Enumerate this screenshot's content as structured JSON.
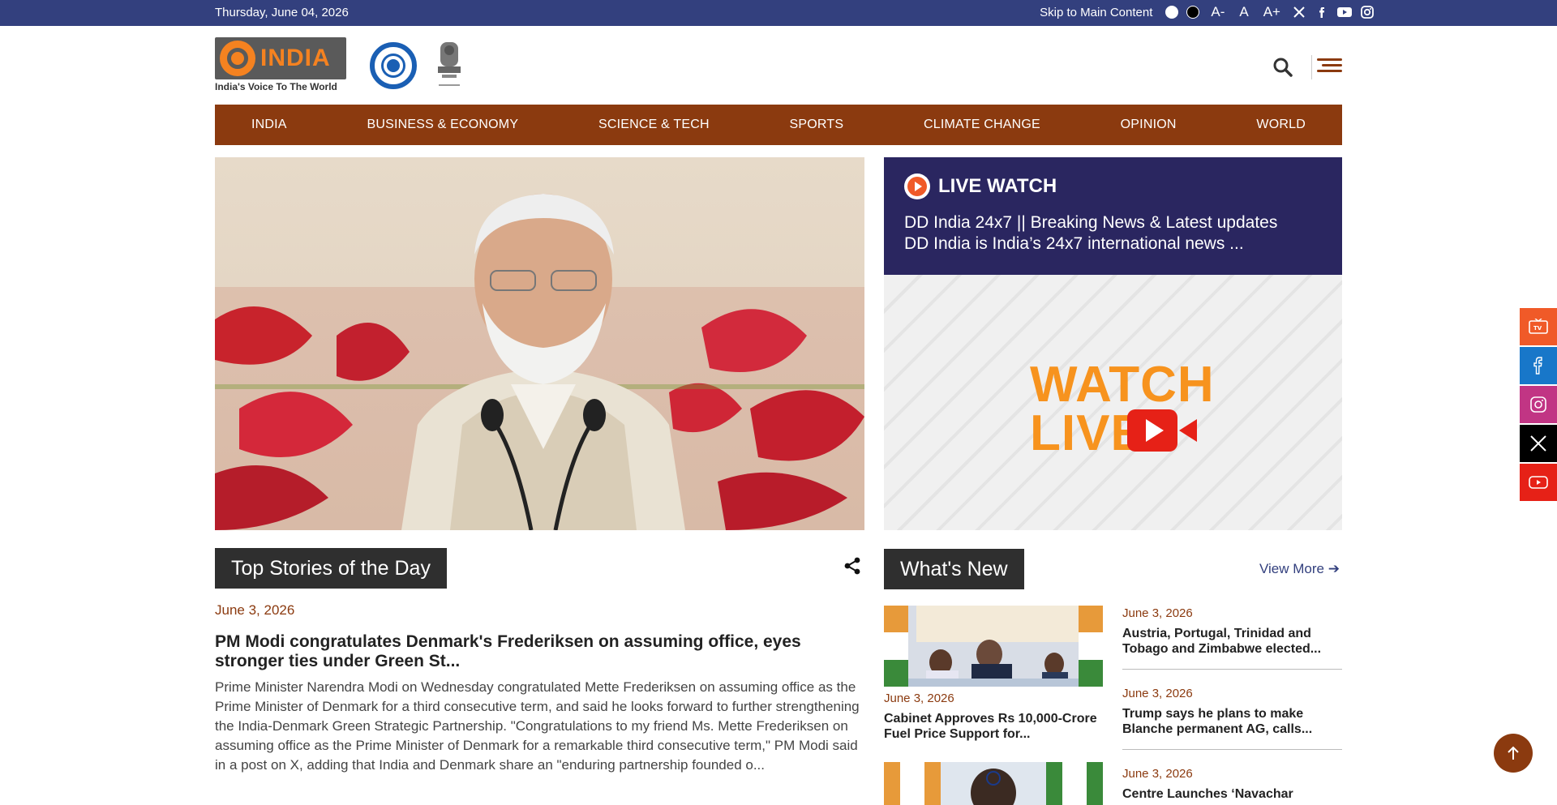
{
  "topbar": {
    "date": "Thursday, June 04, 2026",
    "skip_link": "Skip to Main Content",
    "font_small": "A-",
    "font_normal": "A",
    "font_large": "A+"
  },
  "header": {
    "logo_text": "INDIA",
    "logo_tagline": "India's Voice To The World"
  },
  "nav": {
    "items": [
      "INDIA",
      "BUSINESS & ECONOMY",
      "SCIENCE & TECH",
      "SPORTS",
      "CLIMATE CHANGE",
      "OPINION",
      "WORLD"
    ]
  },
  "live": {
    "heading": "LIVE WATCH",
    "line1": "DD India 24x7 || Breaking News & Latest updates",
    "line2": "DD India is India’s 24x7 international news ...",
    "banner_word1": "WATCH",
    "banner_word2": "LIVE"
  },
  "top_stories": {
    "section_title": "Top Stories of the Day",
    "date": "June 3, 2026",
    "title": "PM Modi congratulates Denmark's Frederiksen on assuming office, eyes stronger ties under Green St...",
    "body": "Prime Minister Narendra Modi on Wednesday congratulated Mette Frederiksen on assuming office as the Prime Minister of Denmark for a third consecutive term, and said he looks forward to further strengthening the India-Denmark Green Strategic Partnership. \"Congratulations to my friend Ms. Mette Frederiksen on assuming office as the Prime Minister of Denmark for a remarkable third consecutive term,\" PM Modi said in a post on X, adding that India and Denmark share an \"enduring partnership founded o..."
  },
  "whats_new": {
    "section_title": "What's New",
    "view_more": "View More",
    "left": [
      {
        "date": "June 3, 2026",
        "title": "Cabinet Approves Rs 10,000-Crore Fuel Price Support for..."
      }
    ],
    "right": [
      {
        "date": "June 3, 2026",
        "title": "Austria, Portugal, Trinidad and Tobago and Zimbabwe elected..."
      },
      {
        "date": "June 3, 2026",
        "title": "Trump says he plans to make Blanche permanent AG, calls..."
      },
      {
        "date": "June 3, 2026",
        "title": "Centre Launches ‘Navachar"
      }
    ]
  },
  "colors": {
    "topbar": "#33407e",
    "nav": "#8b3a0f",
    "live_band": "#2a2660",
    "accent_orange": "#f7931e"
  },
  "icons": {
    "side_social": [
      "tv-icon",
      "facebook-icon",
      "instagram-icon",
      "x-icon",
      "youtube-icon"
    ]
  }
}
